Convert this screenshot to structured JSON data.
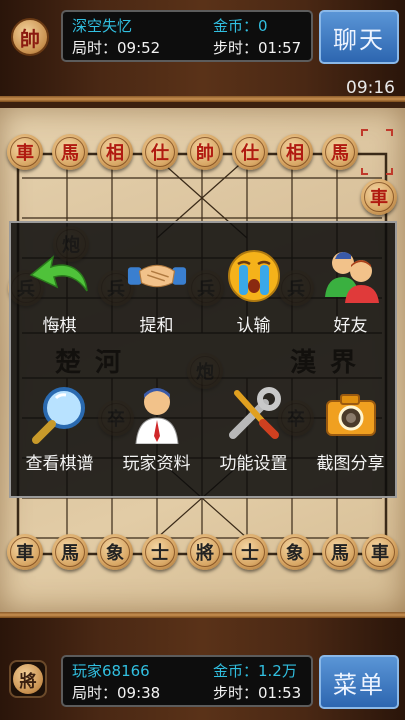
{
  "top_player": {
    "avatar_char": "帥",
    "name": "深空失忆",
    "coins_label": "金币：0",
    "total_time": "局时：09:52",
    "step_time": "步时：01:57",
    "button_label": "聊天"
  },
  "clock": "09:16",
  "board": {
    "top_row": [
      "車",
      "馬",
      "相",
      "仕",
      "帥",
      "仕",
      "相",
      "馬"
    ],
    "side_piece": "車",
    "bottom_row": [
      "車",
      "馬",
      "象",
      "士",
      "將",
      "士",
      "象",
      "馬",
      "車"
    ],
    "river_left": "楚河",
    "river_right": "漢界",
    "partial_pieces": [
      "炮",
      "兵",
      "兵",
      "兵",
      "兵",
      "卒",
      "卒",
      "炮"
    ]
  },
  "menu": {
    "items": [
      {
        "label": "悔棋",
        "icon": "undo-arrow-icon"
      },
      {
        "label": "提和",
        "icon": "handshake-icon"
      },
      {
        "label": "认输",
        "icon": "crying-face-icon"
      },
      {
        "label": "好友",
        "icon": "friends-icon"
      },
      {
        "label": "查看棋谱",
        "icon": "magnifier-icon"
      },
      {
        "label": "玩家资料",
        "icon": "player-profile-icon"
      },
      {
        "label": "功能设置",
        "icon": "wrench-screwdriver-icon"
      },
      {
        "label": "截图分享",
        "icon": "camera-icon"
      }
    ]
  },
  "bottom_player": {
    "avatar_char": "將",
    "name": "玩家68166",
    "coins_label": "金币：1.2万",
    "total_time": "局时：09:38",
    "step_time": "步时：01:53",
    "button_label": "菜单"
  }
}
